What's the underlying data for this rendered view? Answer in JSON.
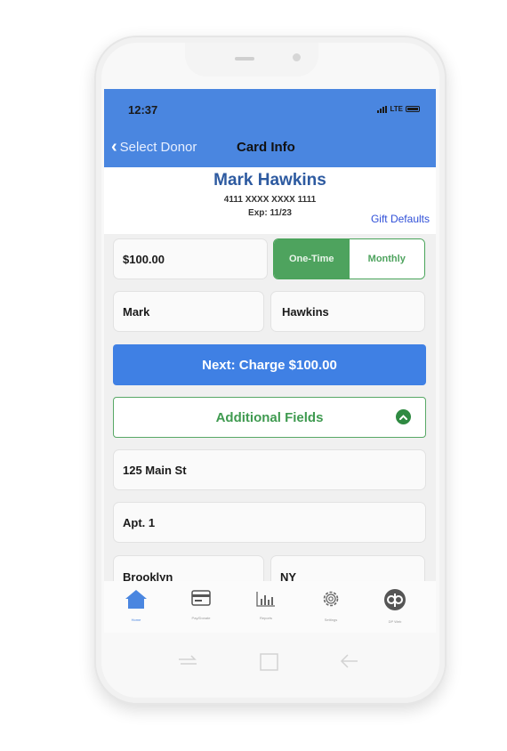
{
  "status_bar": {
    "time": "12:37",
    "network": "LTE"
  },
  "nav": {
    "back_label": "Select Donor",
    "title": "Card Info"
  },
  "donor": {
    "name": "Mark Hawkins",
    "card_number": "4111 XXXX XXXX 1111",
    "expiry": "Exp: 11/23",
    "gift_defaults_link": "Gift Defaults"
  },
  "form": {
    "amount": "$100.00",
    "frequency_options": [
      "One-Time",
      "Monthly"
    ],
    "frequency_selected": "One-Time",
    "first_name": "Mark",
    "last_name": "Hawkins",
    "charge_button": "Next: Charge $100.00",
    "additional_fields_label": "Additional Fields",
    "address1": "125 Main St",
    "address2": "Apt. 1",
    "city": "Brooklyn",
    "state": "NY"
  },
  "tabs": [
    {
      "label": "Home",
      "icon": "home-icon"
    },
    {
      "label": "Pay/Donate",
      "icon": "card-icon"
    },
    {
      "label": "Reports",
      "icon": "chart-icon"
    },
    {
      "label": "Settings",
      "icon": "gear-icon"
    },
    {
      "label": "DP Web",
      "icon": "dp-logo-icon"
    }
  ],
  "colors": {
    "header_blue": "#4a86e0",
    "charge_blue": "#3f80e4",
    "green": "#4ea35e",
    "donor_name": "#2d5aa0",
    "link_blue": "#3050d8"
  }
}
